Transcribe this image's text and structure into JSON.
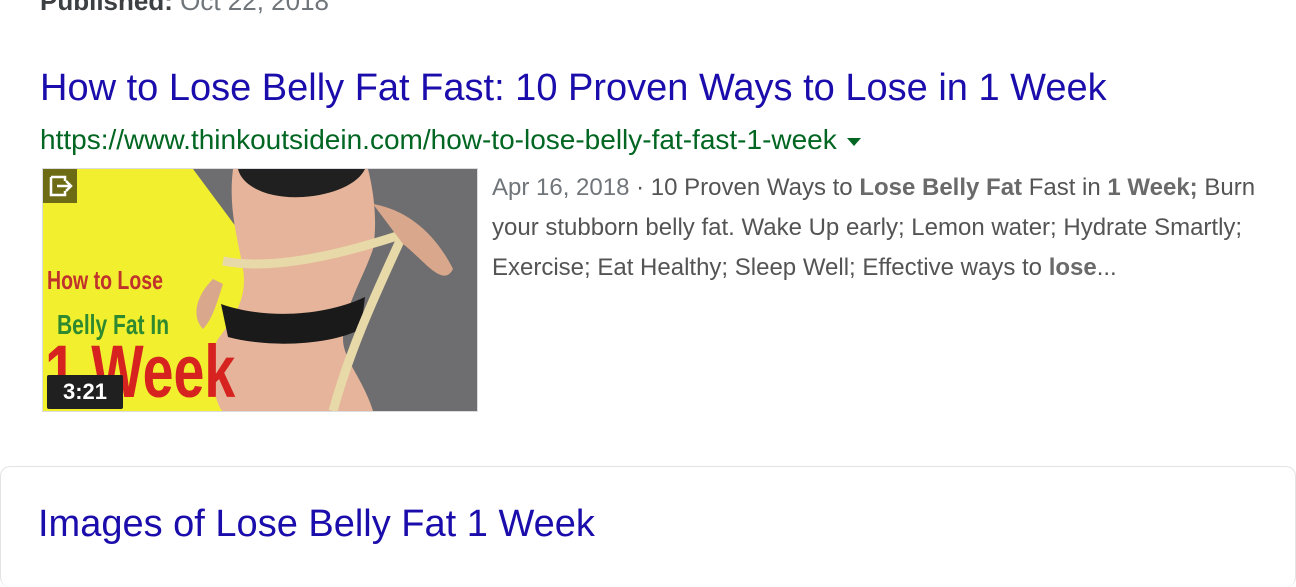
{
  "prev_result": {
    "label": "Published:",
    "value": "Oct 22, 2018"
  },
  "result": {
    "title": "How to Lose Belly Fat Fast: 10 Proven Ways to Lose in 1 Week",
    "url": "https://www.thinkoutsidein.com/how-to-lose-belly-fat-fast-1-week",
    "thumbnail": {
      "text_line1": "How to Lose",
      "text_line2": "Belly Fat In",
      "text_line3": "1 Week",
      "duration": "3:21",
      "share_icon": "share-icon"
    },
    "snippet": {
      "date": "Apr 16, 2018",
      "separator": " · ",
      "p1": "10 Proven Ways to ",
      "b1": "Lose Belly Fat",
      "p2": " Fast in ",
      "b2": "1 Week;",
      "p3": " Burn your stubborn belly fat. Wake Up early; Lemon water; Hydrate Smartly; Exercise; Eat Healthy; Sleep Well; Effective ways to ",
      "b3": "lose",
      "ellipsis": "..."
    }
  },
  "images_section": {
    "title": "Images of Lose Belly Fat 1 Week"
  },
  "colors": {
    "link": "#1a0dab",
    "url": "#006621",
    "snippet": "#545454"
  }
}
